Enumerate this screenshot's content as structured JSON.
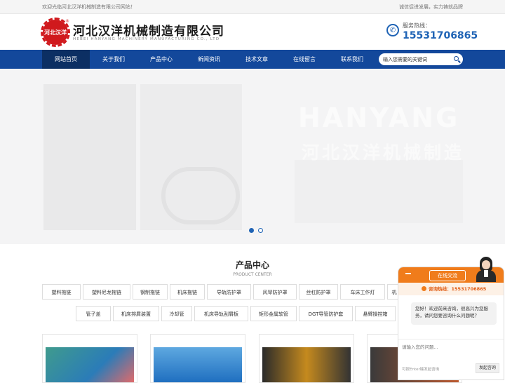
{
  "topbar": {
    "welcome": "欢迎光临河北汉洋机械制造有限公司网站！",
    "slogan": "诚信促进发展，实力铸就品牌"
  },
  "header": {
    "logo_text": "河北汉洋",
    "company_name": "河北汉洋机械制造有限公司",
    "company_name_en": "HEBEI HANYANG MACHINERY MANUFACTURING CO., LTD",
    "hotline_label": "服务热线：",
    "hotline_number": "15531706865"
  },
  "nav": {
    "items": [
      "网站首页",
      "关于我们",
      "产品中心",
      "新闻资讯",
      "技术文章",
      "在线留言",
      "联系我们"
    ],
    "active": 0
  },
  "search": {
    "placeholder": "输入您需要的关键词"
  },
  "banner": {
    "title_en": "HANYANG",
    "title_cn": "河北汉洋机械制造",
    "slides": 2,
    "active_slide": 0
  },
  "products": {
    "title": "产品中心",
    "subtitle": "PRODUCT CENTER",
    "tags_row1": [
      "塑料拖链",
      "塑料尼龙拖链",
      "钢制拖链",
      "机床拖链",
      "导轨防护罩",
      "风琴防护罩",
      "丝杠防护罩",
      "车床工作灯",
      "机"
    ],
    "tags_row2": [
      "管子盖",
      "机床排屑装置",
      "冷却管",
      "机床导轨刮屑板",
      "矩形金属软管",
      "DGT导管防护套",
      "悬臂操控箱"
    ]
  },
  "chat": {
    "title": "在线交流",
    "hotline": "咨询热线：15531706865",
    "greeting": "您好！欢迎前来咨询，很高兴为您服务，请问您要咨询什么问题呢？",
    "input_placeholder": "请输入您的问题...",
    "hint": "可按Enter键发起咨询",
    "send": "发起咨询"
  },
  "colors": {
    "nav": "#13489b",
    "accent": "#1f63b5",
    "chat": "#f07c1b",
    "logo": "#d0191d"
  }
}
